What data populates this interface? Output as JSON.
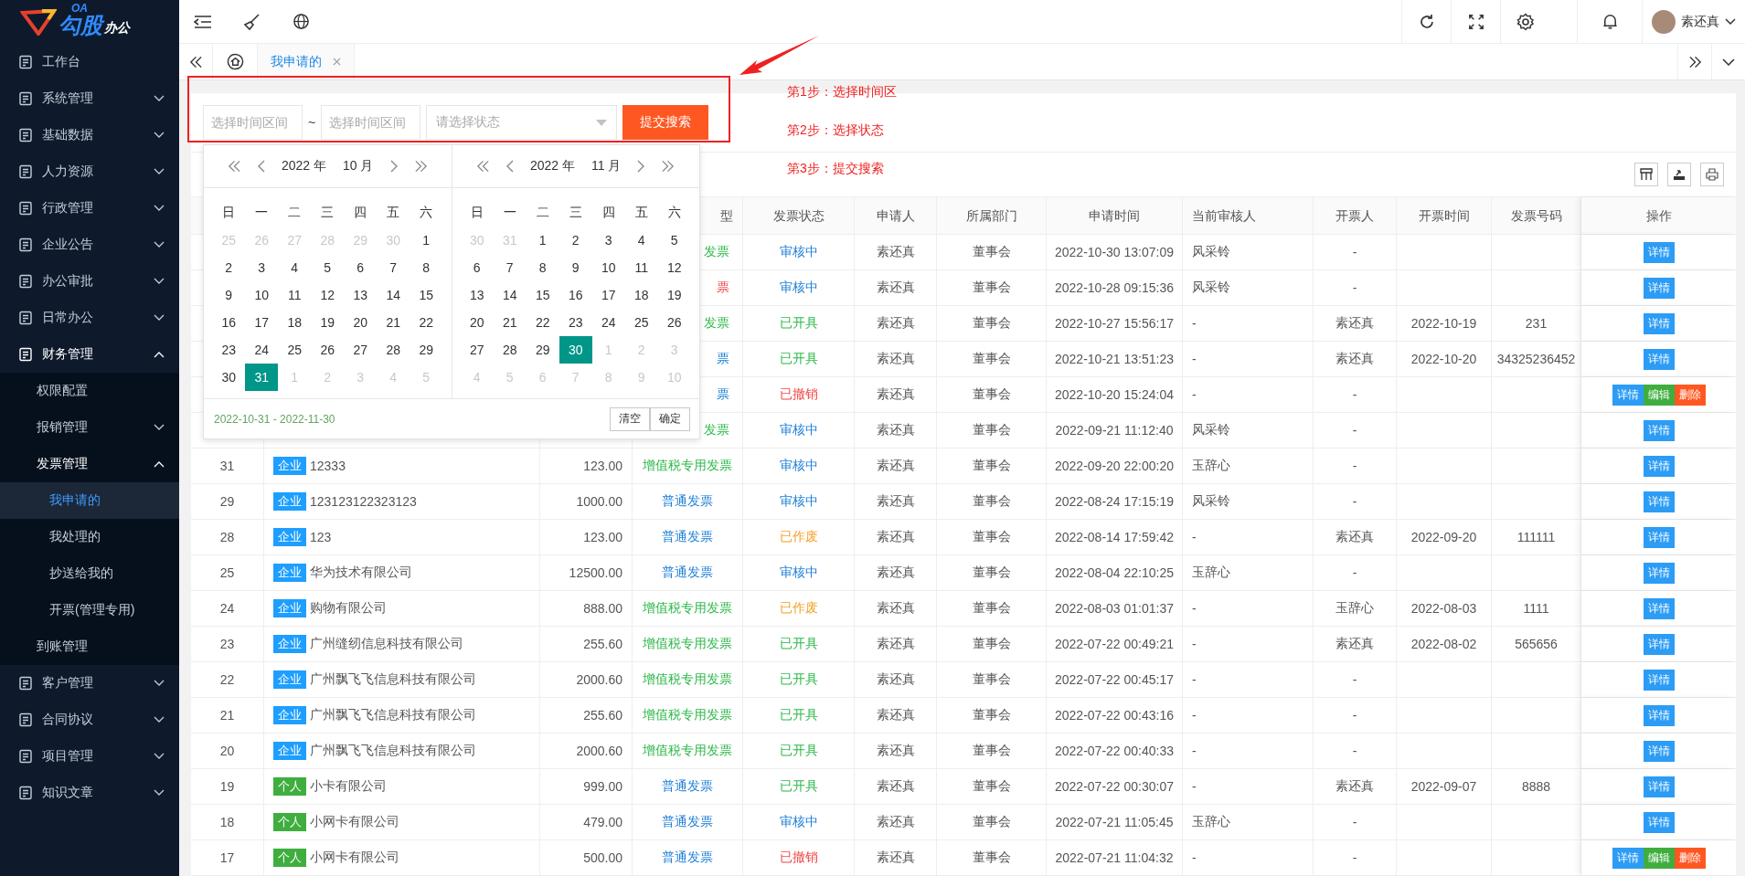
{
  "logo": {
    "small": "OA",
    "main": "勾股",
    "sub": "办公"
  },
  "sidebar": {
    "items": [
      {
        "label": "工作台",
        "kind": "link",
        "selected": false
      },
      {
        "label": "系统管理",
        "kind": "group",
        "expanded": false,
        "selected": false
      },
      {
        "label": "基础数据",
        "kind": "group",
        "expanded": false,
        "selected": false
      },
      {
        "label": "人力资源",
        "kind": "group",
        "expanded": false,
        "selected": false
      },
      {
        "label": "行政管理",
        "kind": "group",
        "expanded": false,
        "selected": false
      },
      {
        "label": "企业公告",
        "kind": "group",
        "expanded": false,
        "selected": false
      },
      {
        "label": "办公审批",
        "kind": "group",
        "expanded": false,
        "selected": false
      },
      {
        "label": "日常办公",
        "kind": "group",
        "expanded": false,
        "selected": false
      },
      {
        "label": "财务管理",
        "kind": "group",
        "expanded": true,
        "selected": false,
        "children": [
          {
            "label": "权限配置",
            "kind": "link",
            "selected": false
          },
          {
            "label": "报销管理",
            "kind": "group",
            "expanded": false,
            "selected": false
          },
          {
            "label": "发票管理",
            "kind": "group",
            "expanded": true,
            "selected": false,
            "children": [
              {
                "label": "我申请的",
                "kind": "link",
                "selected": true
              },
              {
                "label": "我处理的",
                "kind": "link",
                "selected": false
              },
              {
                "label": "抄送给我的",
                "kind": "link",
                "selected": false
              },
              {
                "label": "开票(管理专用)",
                "kind": "link",
                "selected": false
              }
            ]
          },
          {
            "label": "到账管理",
            "kind": "link",
            "selected": false
          }
        ]
      },
      {
        "label": "客户管理",
        "kind": "group",
        "expanded": false,
        "selected": false
      },
      {
        "label": "合同协议",
        "kind": "group",
        "expanded": false,
        "selected": false
      },
      {
        "label": "项目管理",
        "kind": "group",
        "expanded": false,
        "selected": false
      },
      {
        "label": "知识文章",
        "kind": "group",
        "expanded": false,
        "selected": false
      }
    ]
  },
  "header": {
    "user": "素还真"
  },
  "tabs": [
    {
      "label": "我申请的",
      "selected": true
    }
  ],
  "search": {
    "start_placeholder": "选择时间区间",
    "separator": "~",
    "end_placeholder": "选择时间区间",
    "status_placeholder": "请选择状态",
    "submit": "提交搜索"
  },
  "date_picker": {
    "range": "2022-10-31 - 2022-11-30",
    "clear": "清空",
    "confirm": "确定",
    "months": [
      {
        "year": "2022 年",
        "month": "10 月",
        "weekdays": [
          "日",
          "一",
          "二",
          "三",
          "四",
          "五",
          "六"
        ],
        "weeks": [
          [
            {
              "day": "25",
              "muted": true,
              "selected": false
            },
            {
              "day": "26",
              "muted": true,
              "selected": false
            },
            {
              "day": "27",
              "muted": true,
              "selected": false
            },
            {
              "day": "28",
              "muted": true,
              "selected": false
            },
            {
              "day": "29",
              "muted": true,
              "selected": false
            },
            {
              "day": "30",
              "muted": true,
              "selected": false
            },
            {
              "day": "1",
              "muted": false,
              "selected": false
            }
          ],
          [
            {
              "day": "2",
              "muted": false,
              "selected": false
            },
            {
              "day": "3",
              "muted": false,
              "selected": false
            },
            {
              "day": "4",
              "muted": false,
              "selected": false
            },
            {
              "day": "5",
              "muted": false,
              "selected": false
            },
            {
              "day": "6",
              "muted": false,
              "selected": false
            },
            {
              "day": "7",
              "muted": false,
              "selected": false
            },
            {
              "day": "8",
              "muted": false,
              "selected": false
            }
          ],
          [
            {
              "day": "9",
              "muted": false,
              "selected": false
            },
            {
              "day": "10",
              "muted": false,
              "selected": false
            },
            {
              "day": "11",
              "muted": false,
              "selected": false
            },
            {
              "day": "12",
              "muted": false,
              "selected": false
            },
            {
              "day": "13",
              "muted": false,
              "selected": false
            },
            {
              "day": "14",
              "muted": false,
              "selected": false
            },
            {
              "day": "15",
              "muted": false,
              "selected": false
            }
          ],
          [
            {
              "day": "16",
              "muted": false,
              "selected": false
            },
            {
              "day": "17",
              "muted": false,
              "selected": false
            },
            {
              "day": "18",
              "muted": false,
              "selected": false
            },
            {
              "day": "19",
              "muted": false,
              "selected": false
            },
            {
              "day": "20",
              "muted": false,
              "selected": false
            },
            {
              "day": "21",
              "muted": false,
              "selected": false
            },
            {
              "day": "22",
              "muted": false,
              "selected": false
            }
          ],
          [
            {
              "day": "23",
              "muted": false,
              "selected": false
            },
            {
              "day": "24",
              "muted": false,
              "selected": false
            },
            {
              "day": "25",
              "muted": false,
              "selected": false
            },
            {
              "day": "26",
              "muted": false,
              "selected": false
            },
            {
              "day": "27",
              "muted": false,
              "selected": false
            },
            {
              "day": "28",
              "muted": false,
              "selected": false
            },
            {
              "day": "29",
              "muted": false,
              "selected": false
            }
          ],
          [
            {
              "day": "30",
              "muted": false,
              "selected": false
            },
            {
              "day": "31",
              "muted": false,
              "selected": true
            },
            {
              "day": "1",
              "muted": true,
              "selected": false
            },
            {
              "day": "2",
              "muted": true,
              "selected": false
            },
            {
              "day": "3",
              "muted": true,
              "selected": false
            },
            {
              "day": "4",
              "muted": true,
              "selected": false
            },
            {
              "day": "5",
              "muted": true,
              "selected": false
            }
          ]
        ]
      },
      {
        "year": "2022 年",
        "month": "11 月",
        "weekdays": [
          "日",
          "一",
          "二",
          "三",
          "四",
          "五",
          "六"
        ],
        "weeks": [
          [
            {
              "day": "30",
              "muted": true,
              "selected": false
            },
            {
              "day": "31",
              "muted": true,
              "selected": false
            },
            {
              "day": "1",
              "muted": false,
              "selected": false
            },
            {
              "day": "2",
              "muted": false,
              "selected": false
            },
            {
              "day": "3",
              "muted": false,
              "selected": false
            },
            {
              "day": "4",
              "muted": false,
              "selected": false
            },
            {
              "day": "5",
              "muted": false,
              "selected": false
            }
          ],
          [
            {
              "day": "6",
              "muted": false,
              "selected": false
            },
            {
              "day": "7",
              "muted": false,
              "selected": false
            },
            {
              "day": "8",
              "muted": false,
              "selected": false
            },
            {
              "day": "9",
              "muted": false,
              "selected": false
            },
            {
              "day": "10",
              "muted": false,
              "selected": false
            },
            {
              "day": "11",
              "muted": false,
              "selected": false
            },
            {
              "day": "12",
              "muted": false,
              "selected": false
            }
          ],
          [
            {
              "day": "13",
              "muted": false,
              "selected": false
            },
            {
              "day": "14",
              "muted": false,
              "selected": false
            },
            {
              "day": "15",
              "muted": false,
              "selected": false
            },
            {
              "day": "16",
              "muted": false,
              "selected": false
            },
            {
              "day": "17",
              "muted": false,
              "selected": false
            },
            {
              "day": "18",
              "muted": false,
              "selected": false
            },
            {
              "day": "19",
              "muted": false,
              "selected": false
            }
          ],
          [
            {
              "day": "20",
              "muted": false,
              "selected": false
            },
            {
              "day": "21",
              "muted": false,
              "selected": false
            },
            {
              "day": "22",
              "muted": false,
              "selected": false
            },
            {
              "day": "23",
              "muted": false,
              "selected": false
            },
            {
              "day": "24",
              "muted": false,
              "selected": false
            },
            {
              "day": "25",
              "muted": false,
              "selected": false
            },
            {
              "day": "26",
              "muted": false,
              "selected": false
            }
          ],
          [
            {
              "day": "27",
              "muted": false,
              "selected": false
            },
            {
              "day": "28",
              "muted": false,
              "selected": false
            },
            {
              "day": "29",
              "muted": false,
              "selected": false
            },
            {
              "day": "30",
              "muted": false,
              "selected": true
            },
            {
              "day": "1",
              "muted": true,
              "selected": false
            },
            {
              "day": "2",
              "muted": true,
              "selected": false
            },
            {
              "day": "3",
              "muted": true,
              "selected": false
            }
          ],
          [
            {
              "day": "4",
              "muted": true,
              "selected": false
            },
            {
              "day": "5",
              "muted": true,
              "selected": false
            },
            {
              "day": "6",
              "muted": true,
              "selected": false
            },
            {
              "day": "7",
              "muted": true,
              "selected": false
            },
            {
              "day": "8",
              "muted": true,
              "selected": false
            },
            {
              "day": "9",
              "muted": true,
              "selected": false
            },
            {
              "day": "10",
              "muted": true,
              "selected": false
            }
          ]
        ]
      }
    ]
  },
  "annotations": {
    "steps": [
      "第1步：选择时间区",
      "第2步：选择状态",
      "第3步：提交搜索"
    ]
  },
  "table": {
    "columns": [
      {
        "label": "型"
      },
      {
        "label": "发票状态"
      },
      {
        "label": "申请人"
      },
      {
        "label": "所属部门"
      },
      {
        "label": "申请时间"
      },
      {
        "label": "当前审核人"
      },
      {
        "label": "开票人"
      },
      {
        "label": "开票时间"
      },
      {
        "label": "发票号码"
      },
      {
        "label": "操作"
      }
    ],
    "rows": [
      {
        "type": {
          "text": "发票",
          "color": "#2eb84a"
        },
        "status": {
          "text": "审核中",
          "color": "#1e7fd6"
        },
        "applicant": "素还真",
        "dept": "董事会",
        "time": "2022-10-30 13:07:09",
        "reviewer": "风采铃",
        "issuer": "-",
        "actions": [
          {
            "label": "详情",
            "color": "#2d9cf5"
          }
        ]
      },
      {
        "type": {
          "text": "票",
          "color": "#f04848"
        },
        "status": {
          "text": "审核中",
          "color": "#1e7fd6"
        },
        "applicant": "素还真",
        "dept": "董事会",
        "time": "2022-10-28 09:15:36",
        "reviewer": "风采铃",
        "issuer": "-",
        "actions": [
          {
            "label": "详情",
            "color": "#2d9cf5"
          }
        ]
      },
      {
        "type": {
          "text": "发票",
          "color": "#2eb84a"
        },
        "status": {
          "text": "已开具",
          "color": "#2eb84a"
        },
        "applicant": "素还真",
        "dept": "董事会",
        "time": "2022-10-27 15:56:17",
        "reviewer": "-",
        "issuer": "素还真",
        "issue_date": "2022-10-19",
        "invoice_no": "231",
        "actions": [
          {
            "label": "详情",
            "color": "#2d9cf5"
          }
        ]
      },
      {
        "type": {
          "text": "票",
          "color": "#1e7fd6"
        },
        "status": {
          "text": "已开具",
          "color": "#2eb84a"
        },
        "applicant": "素还真",
        "dept": "董事会",
        "time": "2022-10-21 13:51:23",
        "reviewer": "-",
        "issuer": "素还真",
        "issue_date": "2022-10-20",
        "invoice_no": "34325236452",
        "actions": [
          {
            "label": "详情",
            "color": "#2d9cf5"
          }
        ]
      },
      {
        "type": {
          "text": "票",
          "color": "#1e7fd6"
        },
        "status": {
          "text": "已撤销",
          "color": "#f04848"
        },
        "applicant": "素还真",
        "dept": "董事会",
        "time": "2022-10-20 15:24:04",
        "reviewer": "-",
        "issuer": "-",
        "actions": [
          {
            "label": "详情",
            "color": "#2d9cf5"
          },
          {
            "label": "编辑",
            "color": "#3fae3f"
          },
          {
            "label": "删除",
            "color": "#ff5722"
          }
        ]
      },
      {
        "type": {
          "text": "发票",
          "color": "#2eb84a"
        },
        "status": {
          "text": "审核中",
          "color": "#1e7fd6"
        },
        "applicant": "素还真",
        "dept": "董事会",
        "time": "2022-09-21 11:12:40",
        "reviewer": "风采铃",
        "issuer": "-",
        "actions": [
          {
            "label": "详情",
            "color": "#2d9cf5"
          }
        ]
      },
      {
        "id": "31",
        "tag": {
          "text": "企业",
          "color": "#1e9fff"
        },
        "name": "12333",
        "amount": "123.00",
        "type": {
          "text": "增值税专用发票",
          "color": "#2eb84a"
        },
        "status": {
          "text": "审核中",
          "color": "#1e7fd6"
        },
        "applicant": "素还真",
        "dept": "董事会",
        "time": "2022-09-20 22:00:20",
        "reviewer": "玉辞心",
        "issuer": "-",
        "actions": [
          {
            "label": "详情",
            "color": "#2d9cf5"
          }
        ]
      },
      {
        "id": "29",
        "tag": {
          "text": "企业",
          "color": "#1e9fff"
        },
        "name": "123123122323123",
        "amount": "1000.00",
        "type": {
          "text": "普通发票",
          "color": "#1e7fd6"
        },
        "status": {
          "text": "审核中",
          "color": "#1e7fd6"
        },
        "applicant": "素还真",
        "dept": "董事会",
        "time": "2022-08-24 17:15:19",
        "reviewer": "风采铃",
        "issuer": "-",
        "actions": [
          {
            "label": "详情",
            "color": "#2d9cf5"
          }
        ]
      },
      {
        "id": "28",
        "tag": {
          "text": "企业",
          "color": "#1e9fff"
        },
        "name": "123",
        "amount": "123.00",
        "type": {
          "text": "普通发票",
          "color": "#1e7fd6"
        },
        "status": {
          "text": "已作废",
          "color": "#f5a02a"
        },
        "applicant": "素还真",
        "dept": "董事会",
        "time": "2022-08-14 17:59:42",
        "reviewer": "-",
        "issuer": "素还真",
        "issue_date": "2022-09-20",
        "invoice_no": "111111",
        "actions": [
          {
            "label": "详情",
            "color": "#2d9cf5"
          }
        ]
      },
      {
        "id": "25",
        "tag": {
          "text": "企业",
          "color": "#1e9fff"
        },
        "name": "华为技术有限公司",
        "amount": "12500.00",
        "type": {
          "text": "普通发票",
          "color": "#1e7fd6"
        },
        "status": {
          "text": "审核中",
          "color": "#1e7fd6"
        },
        "applicant": "素还真",
        "dept": "董事会",
        "time": "2022-08-04 22:10:25",
        "reviewer": "玉辞心",
        "issuer": "-",
        "actions": [
          {
            "label": "详情",
            "color": "#2d9cf5"
          }
        ]
      },
      {
        "id": "24",
        "tag": {
          "text": "企业",
          "color": "#1e9fff"
        },
        "name": "购物有限公司",
        "amount": "888.00",
        "type": {
          "text": "增值税专用发票",
          "color": "#2eb84a"
        },
        "status": {
          "text": "已作废",
          "color": "#f5a02a"
        },
        "applicant": "素还真",
        "dept": "董事会",
        "time": "2022-08-03 01:01:37",
        "reviewer": "-",
        "issuer": "玉辞心",
        "issue_date": "2022-08-03",
        "invoice_no": "1111",
        "actions": [
          {
            "label": "详情",
            "color": "#2d9cf5"
          }
        ]
      },
      {
        "id": "23",
        "tag": {
          "text": "企业",
          "color": "#1e9fff"
        },
        "name": "广州缝纫信息科技有限公司",
        "amount": "255.60",
        "type": {
          "text": "增值税专用发票",
          "color": "#2eb84a"
        },
        "status": {
          "text": "已开具",
          "color": "#2eb84a"
        },
        "applicant": "素还真",
        "dept": "董事会",
        "time": "2022-07-22 00:49:21",
        "reviewer": "-",
        "issuer": "素还真",
        "issue_date": "2022-08-02",
        "invoice_no": "565656",
        "actions": [
          {
            "label": "详情",
            "color": "#2d9cf5"
          }
        ]
      },
      {
        "id": "22",
        "tag": {
          "text": "企业",
          "color": "#1e9fff"
        },
        "name": "广州飘飞飞信息科技有限公司",
        "amount": "2000.60",
        "type": {
          "text": "增值税专用发票",
          "color": "#2eb84a"
        },
        "status": {
          "text": "已开具",
          "color": "#2eb84a"
        },
        "applicant": "素还真",
        "dept": "董事会",
        "time": "2022-07-22 00:45:17",
        "reviewer": "-",
        "issuer": "-",
        "actions": [
          {
            "label": "详情",
            "color": "#2d9cf5"
          }
        ]
      },
      {
        "id": "21",
        "tag": {
          "text": "企业",
          "color": "#1e9fff"
        },
        "name": "广州飘飞飞信息科技有限公司",
        "amount": "255.60",
        "type": {
          "text": "增值税专用发票",
          "color": "#2eb84a"
        },
        "status": {
          "text": "已开具",
          "color": "#2eb84a"
        },
        "applicant": "素还真",
        "dept": "董事会",
        "time": "2022-07-22 00:43:16",
        "reviewer": "-",
        "issuer": "-",
        "actions": [
          {
            "label": "详情",
            "color": "#2d9cf5"
          }
        ]
      },
      {
        "id": "20",
        "tag": {
          "text": "企业",
          "color": "#1e9fff"
        },
        "name": "广州飘飞飞信息科技有限公司",
        "amount": "2000.60",
        "type": {
          "text": "增值税专用发票",
          "color": "#2eb84a"
        },
        "status": {
          "text": "已开具",
          "color": "#2eb84a"
        },
        "applicant": "素还真",
        "dept": "董事会",
        "time": "2022-07-22 00:40:33",
        "reviewer": "-",
        "issuer": "-",
        "actions": [
          {
            "label": "详情",
            "color": "#2d9cf5"
          }
        ]
      },
      {
        "id": "19",
        "tag": {
          "text": "个人",
          "color": "#3fae3f"
        },
        "name": "小卡有限公司",
        "amount": "999.00",
        "type": {
          "text": "普通发票",
          "color": "#1e7fd6"
        },
        "status": {
          "text": "已开具",
          "color": "#2eb84a"
        },
        "applicant": "素还真",
        "dept": "董事会",
        "time": "2022-07-22 00:30:07",
        "reviewer": "-",
        "issuer": "素还真",
        "issue_date": "2022-09-07",
        "invoice_no": "8888",
        "actions": [
          {
            "label": "详情",
            "color": "#2d9cf5"
          }
        ]
      },
      {
        "id": "18",
        "tag": {
          "text": "个人",
          "color": "#3fae3f"
        },
        "name": "小网卡有限公司",
        "amount": "479.00",
        "type": {
          "text": "普通发票",
          "color": "#1e7fd6"
        },
        "status": {
          "text": "审核中",
          "color": "#1e7fd6"
        },
        "applicant": "素还真",
        "dept": "董事会",
        "time": "2022-07-21 11:05:45",
        "reviewer": "玉辞心",
        "issuer": "-",
        "actions": [
          {
            "label": "详情",
            "color": "#2d9cf5"
          }
        ]
      },
      {
        "id": "17",
        "tag": {
          "text": "个人",
          "color": "#3fae3f"
        },
        "name": "小网卡有限公司",
        "amount": "500.00",
        "type": {
          "text": "普通发票",
          "color": "#1e7fd6"
        },
        "status": {
          "text": "已撤销",
          "color": "#f04848"
        },
        "applicant": "素还真",
        "dept": "董事会",
        "time": "2022-07-21 11:04:32",
        "reviewer": "-",
        "issuer": "-",
        "actions": [
          {
            "label": "详情",
            "color": "#2d9cf5"
          },
          {
            "label": "编辑",
            "color": "#3fae3f"
          },
          {
            "label": "删除",
            "color": "#ff5722"
          }
        ]
      }
    ]
  }
}
